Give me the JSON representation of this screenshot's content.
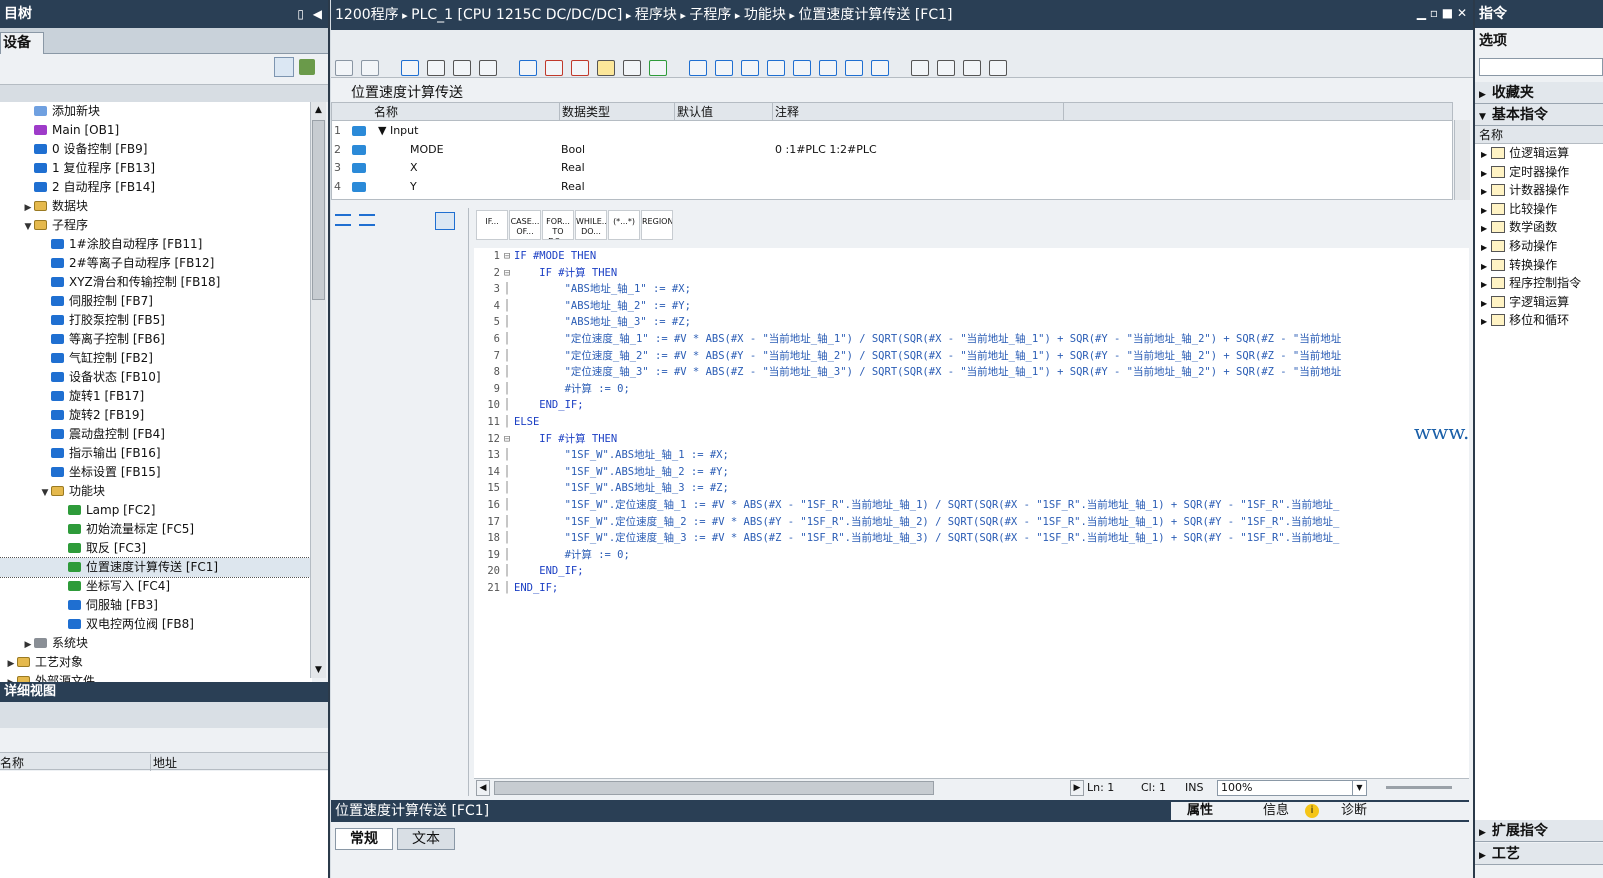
{
  "left": {
    "title": "目树",
    "tab": "设备",
    "tree": [
      {
        "label": "添加新块",
        "icon": "add",
        "indent": 2,
        "arrow": ""
      },
      {
        "label": "Main [OB1]",
        "icon": "purple",
        "indent": 2,
        "arrow": ""
      },
      {
        "label": "0 设备控制 [FB9]",
        "icon": "blue",
        "indent": 2,
        "arrow": ""
      },
      {
        "label": "1 复位程序 [FB13]",
        "icon": "blue",
        "indent": 2,
        "arrow": ""
      },
      {
        "label": "2 自动程序 [FB14]",
        "icon": "blue",
        "indent": 2,
        "arrow": ""
      },
      {
        "label": "数据块",
        "icon": "folder",
        "indent": 2,
        "arrow": "▶"
      },
      {
        "label": "子程序",
        "icon": "folder",
        "indent": 2,
        "arrow": "▼"
      },
      {
        "label": "1#涂胶自动程序 [FB11]",
        "icon": "blue",
        "indent": 3,
        "arrow": ""
      },
      {
        "label": "2#等离子自动程序 [FB12]",
        "icon": "blue",
        "indent": 3,
        "arrow": ""
      },
      {
        "label": "XYZ滑台和传输控制 [FB18]",
        "icon": "blue",
        "indent": 3,
        "arrow": ""
      },
      {
        "label": "伺服控制 [FB7]",
        "icon": "blue",
        "indent": 3,
        "arrow": ""
      },
      {
        "label": "打胶泵控制 [FB5]",
        "icon": "blue",
        "indent": 3,
        "arrow": ""
      },
      {
        "label": "等离子控制 [FB6]",
        "icon": "blue",
        "indent": 3,
        "arrow": ""
      },
      {
        "label": "气缸控制 [FB2]",
        "icon": "blue",
        "indent": 3,
        "arrow": ""
      },
      {
        "label": "设备状态 [FB10]",
        "icon": "blue",
        "indent": 3,
        "arrow": ""
      },
      {
        "label": "旋转1 [FB17]",
        "icon": "blue",
        "indent": 3,
        "arrow": ""
      },
      {
        "label": "旋转2 [FB19]",
        "icon": "blue",
        "indent": 3,
        "arrow": ""
      },
      {
        "label": "震动盘控制 [FB4]",
        "icon": "blue",
        "indent": 3,
        "arrow": ""
      },
      {
        "label": "指示输出 [FB16]",
        "icon": "blue",
        "indent": 3,
        "arrow": ""
      },
      {
        "label": "坐标设置 [FB15]",
        "icon": "blue",
        "indent": 3,
        "arrow": ""
      },
      {
        "label": "功能块",
        "icon": "folder",
        "indent": 3,
        "arrow": "▼"
      },
      {
        "label": "Lamp [FC2]",
        "icon": "green",
        "indent": 4,
        "arrow": ""
      },
      {
        "label": "初始流量标定 [FC5]",
        "icon": "green",
        "indent": 4,
        "arrow": ""
      },
      {
        "label": "取反 [FC3]",
        "icon": "green",
        "indent": 4,
        "arrow": ""
      },
      {
        "label": "位置速度计算传送 [FC1]",
        "icon": "green",
        "indent": 4,
        "arrow": "",
        "selected": true
      },
      {
        "label": "坐标写入 [FC4]",
        "icon": "green",
        "indent": 4,
        "arrow": ""
      },
      {
        "label": "伺服轴 [FB3]",
        "icon": "blue",
        "indent": 4,
        "arrow": ""
      },
      {
        "label": "双电控两位阀 [FB8]",
        "icon": "blue",
        "indent": 4,
        "arrow": ""
      },
      {
        "label": "系统块",
        "icon": "gray",
        "indent": 2,
        "arrow": "▶"
      },
      {
        "label": "工艺对象",
        "icon": "folder",
        "indent": 1,
        "arrow": "▶"
      },
      {
        "label": "外部源文件",
        "icon": "folder",
        "indent": 1,
        "arrow": "▶"
      }
    ],
    "detail_title": "详细视图",
    "detail_cols": [
      "名称",
      "地址"
    ]
  },
  "center": {
    "breadcrumb": [
      "1200程序",
      "PLC_1 [CPU 1215C DC/DC/DC]",
      "程序块",
      "子程序",
      "功能块",
      "位置速度计算传送 [FC1]"
    ],
    "block_title": "位置速度计算传送",
    "iface_cols": [
      "名称",
      "数据类型",
      "默认值",
      "注释"
    ],
    "iface_rows": [
      {
        "num": "1",
        "name": "▼ Input",
        "type": "",
        "default": "",
        "comment": ""
      },
      {
        "num": "2",
        "name": "MODE",
        "type": "Bool",
        "default": "",
        "comment": "0 :1#PLC 1:2#PLC"
      },
      {
        "num": "3",
        "name": "X",
        "type": "Real",
        "default": "",
        "comment": ""
      },
      {
        "num": "4",
        "name": "Y",
        "type": "Real",
        "default": "",
        "comment": ""
      }
    ],
    "snippets": [
      "IF...",
      "CASE... OF...",
      "FOR... TO DO...",
      "WHILE... DO...",
      "(*...*)",
      "REGION"
    ],
    "code": [
      {
        "n": "1",
        "t": "IF #MODE THEN",
        "k": true
      },
      {
        "n": "2",
        "t": "    IF #计算 THEN",
        "k": true
      },
      {
        "n": "3",
        "t": "        \"ABS地址_轴_1\" := #X;"
      },
      {
        "n": "4",
        "t": "        \"ABS地址_轴_2\" := #Y;"
      },
      {
        "n": "5",
        "t": "        \"ABS地址_轴_3\" := #Z;"
      },
      {
        "n": "6",
        "t": "        \"定位速度_轴_1\" := #V * ABS(#X - \"当前地址_轴_1\") / SQRT(SQR(#X - \"当前地址_轴_1\") + SQR(#Y - \"当前地址_轴_2\") + SQR(#Z - \"当前地址"
      },
      {
        "n": "7",
        "t": "        \"定位速度_轴_2\" := #V * ABS(#Y - \"当前地址_轴_2\") / SQRT(SQR(#X - \"当前地址_轴_1\") + SQR(#Y - \"当前地址_轴_2\") + SQR(#Z - \"当前地址"
      },
      {
        "n": "8",
        "t": "        \"定位速度_轴_3\" := #V * ABS(#Z - \"当前地址_轴_3\") / SQRT(SQR(#X - \"当前地址_轴_1\") + SQR(#Y - \"当前地址_轴_2\") + SQR(#Z - \"当前地址"
      },
      {
        "n": "9",
        "t": "        #计算 := 0;"
      },
      {
        "n": "10",
        "t": "    END_IF;",
        "k": true
      },
      {
        "n": "11",
        "t": "ELSE",
        "k": true
      },
      {
        "n": "12",
        "t": "    IF #计算 THEN",
        "k": true
      },
      {
        "n": "13",
        "t": "        \"1SF_W\".ABS地址_轴_1 := #X;"
      },
      {
        "n": "14",
        "t": "        \"1SF_W\".ABS地址_轴_2 := #Y;"
      },
      {
        "n": "15",
        "t": "        \"1SF_W\".ABS地址_轴_3 := #Z;"
      },
      {
        "n": "16",
        "t": "        \"1SF_W\".定位速度_轴_1 := #V * ABS(#X - \"1SF_R\".当前地址_轴_1) / SQRT(SQR(#X - \"1SF_R\".当前地址_轴_1) + SQR(#Y - \"1SF_R\".当前地址_"
      },
      {
        "n": "17",
        "t": "        \"1SF_W\".定位速度_轴_2 := #V * ABS(#Y - \"1SF_R\".当前地址_轴_2) / SQRT(SQR(#X - \"1SF_R\".当前地址_轴_1) + SQR(#Y - \"1SF_R\".当前地址_"
      },
      {
        "n": "18",
        "t": "        \"1SF_W\".定位速度_轴_3 := #V * ABS(#Z - \"1SF_R\".当前地址_轴_3) / SQRT(SQR(#X - \"1SF_R\".当前地址_轴_1) + SQR(#Y - \"1SF_R\".当前地址_"
      },
      {
        "n": "19",
        "t": "        #计算 := 0;"
      },
      {
        "n": "20",
        "t": "    END_IF;",
        "k": true
      },
      {
        "n": "21",
        "t": "END_IF;",
        "k": true
      }
    ],
    "watermark": "www.eleok.com",
    "status": {
      "ln": "Ln: 1",
      "cl": "Cl: 1",
      "ins": "INS",
      "zoom": "100%"
    },
    "bottom_title": "位置速度计算传送 [FC1]",
    "bottom_tabs_right": [
      "属性",
      "信息",
      "诊断"
    ],
    "bottom_tabs": [
      "常规",
      "文本"
    ]
  },
  "right": {
    "title": "指令",
    "options": "选项",
    "favorites": "收藏夹",
    "basic": "基本指令",
    "col_name": "名称",
    "items": [
      "位逻辑运算",
      "定时器操作",
      "计数器操作",
      "比较操作",
      "数学函数",
      "移动操作",
      "转换操作",
      "程序控制指令",
      "字逻辑运算",
      "移位和循环"
    ],
    "extended": "扩展指令",
    "tech": "工艺"
  }
}
